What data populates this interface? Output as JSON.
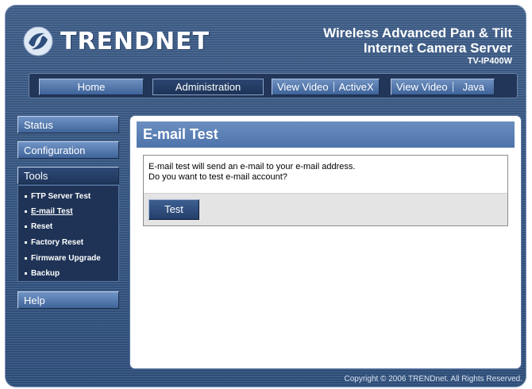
{
  "header": {
    "brand": "TRENDNET",
    "product_line1": "Wireless Advanced Pan & Tilt",
    "product_line2": "Internet Camera Server",
    "model": "TV-IP400W"
  },
  "nav": {
    "home": "Home",
    "administration": "Administration",
    "view_video_1": "View Video",
    "activex": "ActiveX",
    "view_video_2": "View Video",
    "java": "Java"
  },
  "sidebar": {
    "status": "Status",
    "configuration": "Configuration",
    "tools": "Tools",
    "tools_items": [
      "FTP Server Test",
      "E-mail Test",
      "Reset",
      "Factory Reset",
      "Firmware Upgrade",
      "Backup"
    ],
    "help": "Help"
  },
  "main": {
    "title": "E-mail Test",
    "message_line1": "E-mail test will send an e-mail to your e-mail address.",
    "message_line2": "Do you want to test e-mail account?",
    "test_button": "Test"
  },
  "footer": {
    "copyright": "Copyright © 2006 TRENDnet. All Rights Reserved."
  },
  "colors": {
    "frame": "#3f5f8a",
    "nav_bar": "#22365a",
    "button_blue": "#4f75ab",
    "panel_header": "#5a80b6"
  },
  "icons": {
    "logo": "trendnet-logo-icon"
  }
}
